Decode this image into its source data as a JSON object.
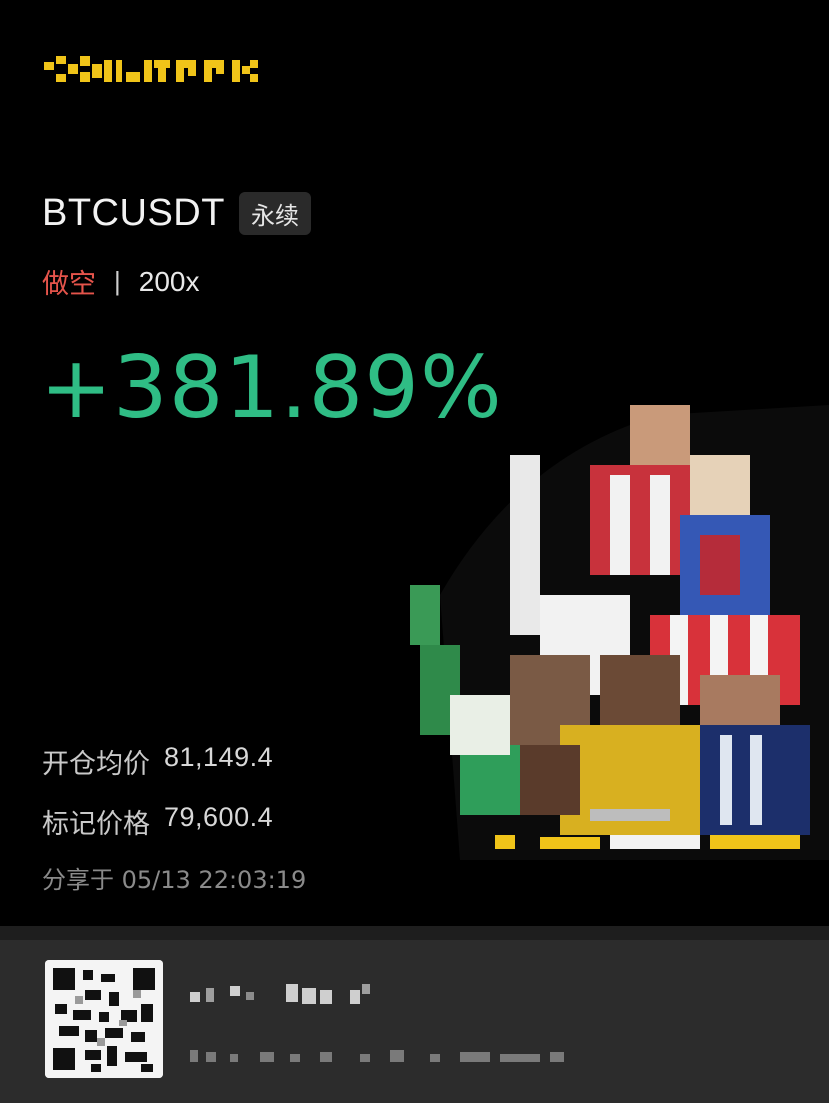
{
  "brand": {
    "logo_icon": "pixelated-brand-logo",
    "accent_color": "#f0c419"
  },
  "trade": {
    "pair": "BTCUSDT",
    "contract_type": "永续",
    "side": "做空",
    "separator": "|",
    "leverage": "200x",
    "pnl_percent": "+381.89%",
    "pnl_color": "#2fbd85",
    "side_color": "#e5544b"
  },
  "details": {
    "open_price_label": "开仓均价",
    "open_price_value": "81,149.4",
    "mark_price_label": "标记价格",
    "mark_price_value": "79,600.4",
    "shared_at": "分享于 05/13 22:03:19"
  },
  "promo": {
    "image_icon": "pixelated-football-players-image"
  },
  "footer": {
    "qr_icon": "qr-code-icon",
    "blurred_text_icon": "pixelated-text"
  }
}
